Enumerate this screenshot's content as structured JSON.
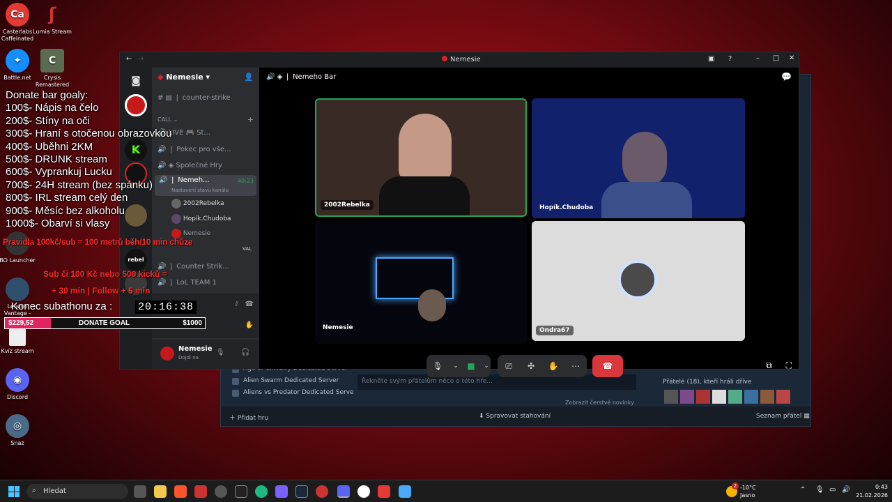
{
  "desktop": {
    "icons": [
      {
        "label": "Casterlabs Caffeinated",
        "glyph": "Ca",
        "color": "#e53935"
      },
      {
        "label": "Lumia Stream",
        "glyph": "ʃ",
        "color": "#8a1c1c"
      },
      {
        "label": "Battle.net",
        "glyph": "✦",
        "color": "#148eff"
      },
      {
        "label": "Crysis Remastered",
        "glyph": "C",
        "color": "#5a6b52"
      },
      {
        "label": "BO Launcher",
        "glyph": "",
        "color": "#333"
      },
      {
        "label": "Lenovo Vantage - zástupce",
        "glyph": "",
        "color": "#333"
      },
      {
        "label": "Kvíz stream",
        "glyph": "",
        "color": "#ddd"
      },
      {
        "label": "Discord",
        "glyph": "◉",
        "color": "#5865f2"
      },
      {
        "label": "Snaz",
        "glyph": "◎",
        "color": "#4a6a8a"
      }
    ]
  },
  "overlay": {
    "goals_title": "Donate bar goaly:",
    "goals": [
      "100$- Nápis na čelo",
      "200$- Stíny na oči",
      "300$- Hraní s otočenou obrazovkou",
      "400$- Uběhni 2KM",
      "500$- DRUNK stream",
      "600$- Vyprankuj Lucku",
      "700$- 24H stream (bez spánku)",
      "800$-  IRL stream celý den",
      "900$- Měsíc bez alkoholu",
      "1000$- Obarví si vlasy"
    ],
    "rules": "Pravidla 100kč/sub = 100 metrů běh/10 min chůze",
    "sub_line1": "Sub či 100 Kč nebo 500 kicků =",
    "sub_line2": "+ 30 min | Follow + 5 min",
    "subathon_label": "Konec subathonu za :",
    "timer": "20:16:38",
    "donate_current": "$229,52",
    "donate_label": "DONATE GOAL",
    "donate_target": "$1000",
    "donate_progress": 0.23
  },
  "discord": {
    "window_title": "Nemesie",
    "server_name": "Nemesie",
    "channels": {
      "text_channel": "counter-strike",
      "category": "CALL",
      "items": [
        {
          "name": "LIVE 🎮 St..."
        },
        {
          "name": "Pokec pro vše..."
        },
        {
          "name": "Společné Hry"
        },
        {
          "name": "Nemeh...",
          "time": "40:23",
          "sub": "Nastavení stavu kanálu"
        }
      ],
      "members": [
        {
          "name": "2002Rebelka"
        },
        {
          "name": "Hopík.Chudoba"
        },
        {
          "name": "Nemesie"
        }
      ],
      "extra_member_tag": "VAL",
      "channels_after": [
        "Counter Strik...",
        "LoL TEAM 1"
      ]
    },
    "user": {
      "name": "Nemesie",
      "status": "Dojdi na"
    },
    "stage_header": "Nemeho Bar",
    "tiles": [
      {
        "name": "2002Rebelka",
        "bg": "#3a2a26"
      },
      {
        "name": "Hopík.Chudoba",
        "bg": "#12216b"
      },
      {
        "name": "Nemesie",
        "bg": "#05050d"
      },
      {
        "name": "Ondra67",
        "bg": "#dcdcdc"
      }
    ],
    "controls": {
      "mic": "mic-icon",
      "camera": "camera-icon",
      "share": "screen-share-icon",
      "activities": "activities-icon",
      "soundboard": "soundboard-icon",
      "more": "more-icon",
      "hangup": "hangup-icon"
    }
  },
  "steam": {
    "server_list": [
      "Age of Chivalry Dedicated Server",
      "Alien Swarm Dedicated Server",
      "Aliens vs Predator Dedicated Serve"
    ],
    "comment_placeholder": "Řekněte svým přátelům něco o této hře...",
    "friends_label": "Přátelé (18), kteří hráli dříve",
    "news_link": "Zobrazit čerstvé novinky",
    "footer_add": "Přidat hru",
    "footer_downloads": "Spravovat stahování",
    "footer_friends": "Seznam přátel"
  },
  "taskbar": {
    "search_placeholder": "Hledat",
    "weather_temp": "-10°C",
    "weather_desc": "Jasno",
    "weather_badge": "2",
    "time": "0:43",
    "date": "21.02.2026"
  }
}
